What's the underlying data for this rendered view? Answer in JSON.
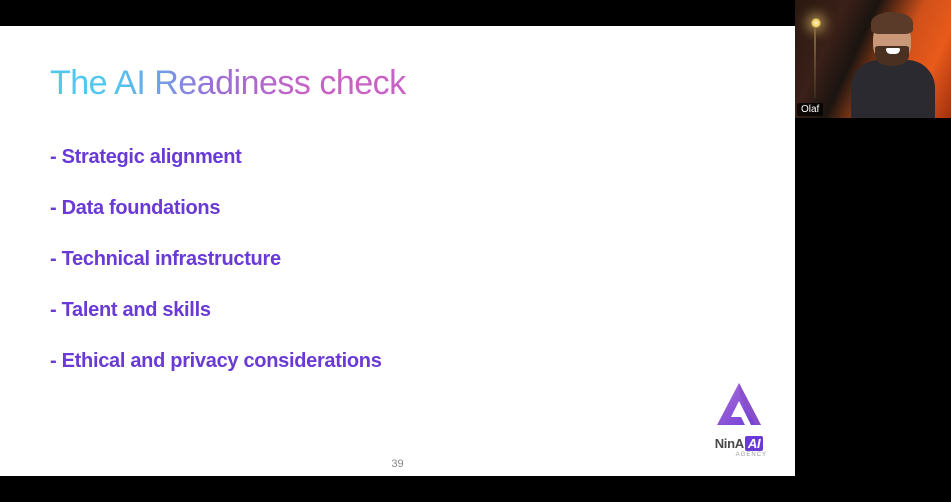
{
  "slide": {
    "title_part1": "The ",
    "title_part2": "AI Readiness",
    "title_part3": " check",
    "bullets": [
      "Strategic alignment",
      "Data foundations",
      "Technical infrastructure",
      "Talent and skills",
      "Ethical and privacy considerations"
    ],
    "page_number": "39"
  },
  "logo": {
    "brand_prefix": "Nin",
    "brand_suffix": "AI",
    "tagline": "AGENCY"
  },
  "webcam": {
    "participant_name": "Olaf"
  }
}
